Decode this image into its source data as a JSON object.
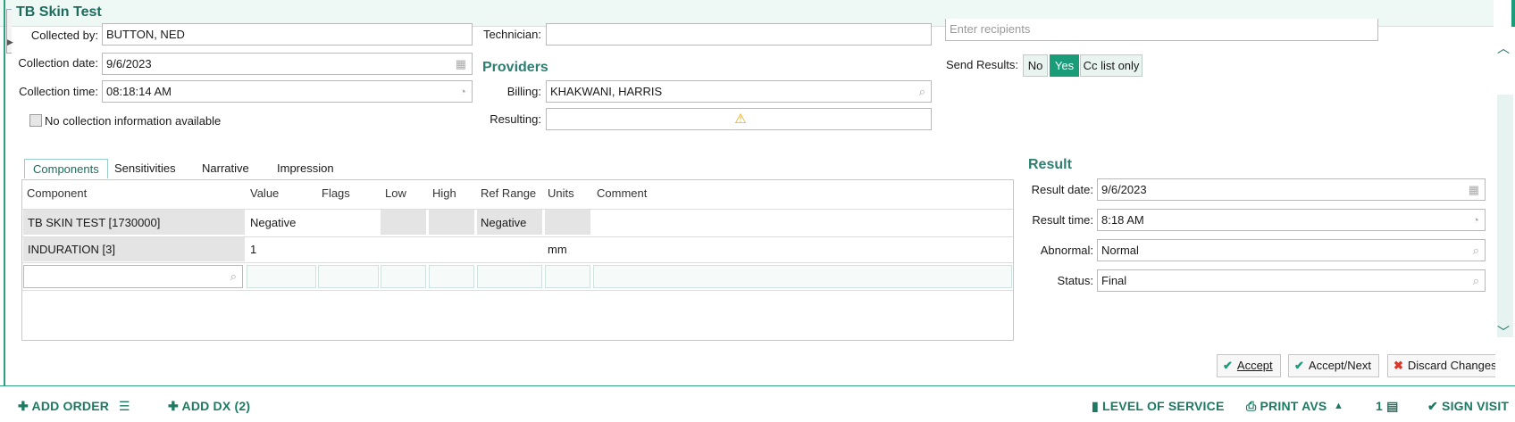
{
  "header": {
    "title": "TB Skin Test"
  },
  "collection": {
    "collected_by_label": "Collected by:",
    "collected_by_value": "BUTTON, NED",
    "date_label": "Collection date:",
    "date_value": "9/6/2023",
    "time_label": "Collection time:",
    "time_value": "08:18:14 AM",
    "no_info_label": "No collection information available"
  },
  "technician": {
    "label": "Technician:",
    "value": ""
  },
  "providers": {
    "heading": "Providers",
    "billing_label": "Billing:",
    "billing_value": "KHAKWANI, HARRIS",
    "resulting_label": "Resulting:",
    "resulting_warning": "⚠"
  },
  "recipients": {
    "placeholder": "Enter recipients"
  },
  "send_results": {
    "label": "Send Results:",
    "options": [
      "No",
      "Yes",
      "Cc list only"
    ],
    "selected": "Yes"
  },
  "tabs": [
    {
      "label": "Components",
      "active": true
    },
    {
      "label": "Sensitivities",
      "active": false
    },
    {
      "label": "Narrative",
      "active": false
    },
    {
      "label": "Impression",
      "active": false
    }
  ],
  "grid": {
    "headers": [
      "Component",
      "Value",
      "Flags",
      "Low",
      "High",
      "Ref Range",
      "Units",
      "Comment"
    ],
    "rows": [
      {
        "component": "TB SKIN TEST [1730000]",
        "value": "Negative",
        "flags": "",
        "low": "",
        "high": "",
        "ref_range": "Negative",
        "units": "",
        "comment": ""
      },
      {
        "component": "INDURATION [3]",
        "value": "1",
        "flags": "",
        "low": "",
        "high": "",
        "ref_range": "",
        "units": "mm",
        "comment": ""
      }
    ]
  },
  "result": {
    "heading": "Result",
    "date_label": "Result date:",
    "date_value": "9/6/2023",
    "time_label": "Result time:",
    "time_value": "8:18 AM",
    "abnormal_label": "Abnormal:",
    "abnormal_value": "Normal",
    "status_label": "Status:",
    "status_value": "Final"
  },
  "actions": {
    "accept": "Accept",
    "accept_next": "Accept/Next",
    "discard": "Discard Changes"
  },
  "footer": {
    "add_order": "ADD ORDER",
    "add_dx": "ADD DX (2)",
    "level_of_service": "LEVEL OF SERVICE",
    "print_avs": "PRINT AVS",
    "clipboard_count": "1",
    "sign_visit": "SIGN VISIT"
  },
  "colors": {
    "accent": "#1b9c79",
    "heading": "#2c7f70",
    "warning": "#f0b400",
    "discard": "#d9372b"
  }
}
